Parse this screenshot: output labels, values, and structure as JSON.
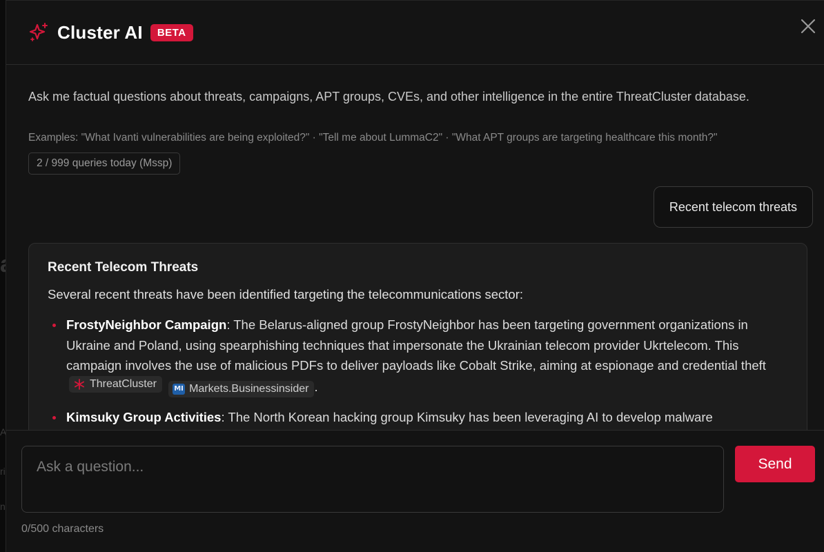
{
  "header": {
    "title": "Cluster AI",
    "badge": "BETA",
    "accent": "#d4173a"
  },
  "intro": {
    "description": "Ask me factual questions about threats, campaigns, APT groups, CVEs, and other intelligence in the entire ThreatCluster database.",
    "examples": "Examples: \"What Ivanti vulnerabilities are being exploited?\" · \"Tell me about LummaC2\" · \"What APT groups are targeting healthcare this month?\"",
    "quota": "2 / 999 queries today (Mssp)"
  },
  "conversation": {
    "user_message": "Recent telecom threats",
    "answer": {
      "title": "Recent Telecom Threats",
      "lead": "Several recent threats have been identified targeting the telecommunications sector:",
      "items": [
        {
          "name": "FrostyNeighbor Campaign",
          "text": ": The Belarus-aligned group FrostyNeighbor has been targeting government organizations in Ukraine and Poland, using spearphishing techniques that impersonate the Ukrainian telecom provider Ukrtelecom. This campaign involves the use of malicious PDFs to deliver payloads like Cobalt Strike, aiming at espionage and credential theft",
          "sources": [
            {
              "label": "ThreatCluster",
              "icon": "threatcluster-icon"
            },
            {
              "label": "Markets.Businessinsider",
              "icon": "businessinsider-icon"
            }
          ],
          "trail": "."
        },
        {
          "name": "Kimsuky Group Activities",
          "text": ": The North Korean hacking group Kimsuky has been leveraging AI to develop malware"
        }
      ]
    }
  },
  "composer": {
    "placeholder": "Ask a question...",
    "send_label": "Send",
    "char_count": "0/500 characters"
  },
  "background": {
    "frag_a": "a",
    "frag_b": "A",
    "frag_c": "ri",
    "frag_d": "n"
  }
}
